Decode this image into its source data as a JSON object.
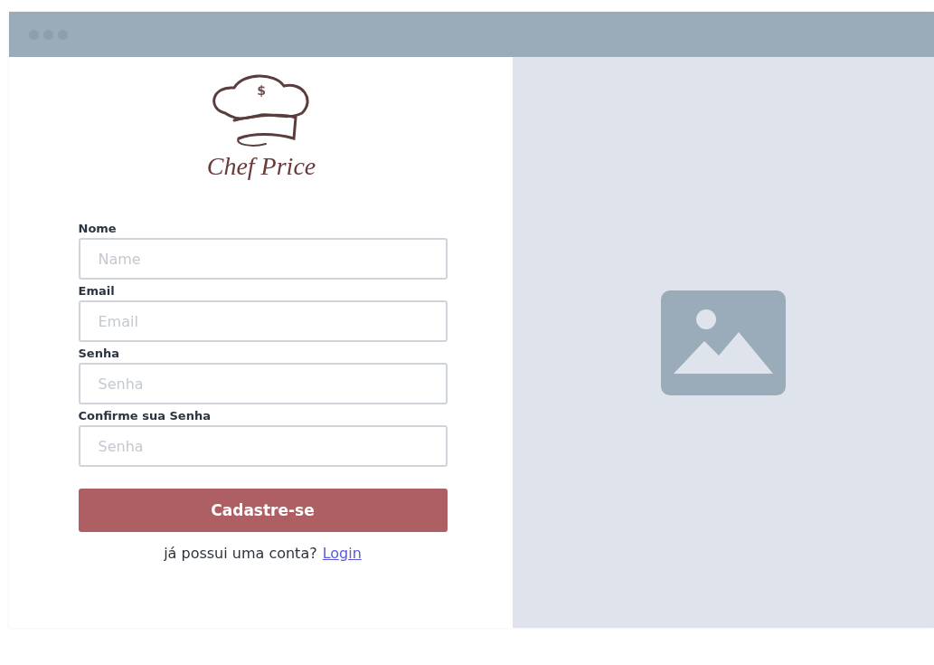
{
  "logo": {
    "mark": "$",
    "name": "Chef Price"
  },
  "form": {
    "fields": [
      {
        "label": "Nome",
        "placeholder": "Name"
      },
      {
        "label": "Email",
        "placeholder": "Email"
      },
      {
        "label": "Senha",
        "placeholder": "Senha"
      },
      {
        "label": "Confirme sua Senha",
        "placeholder": "Senha"
      }
    ],
    "submit": "Cadastre-se",
    "footer": {
      "text": "já possui uma conta?",
      "link": "Login"
    }
  }
}
